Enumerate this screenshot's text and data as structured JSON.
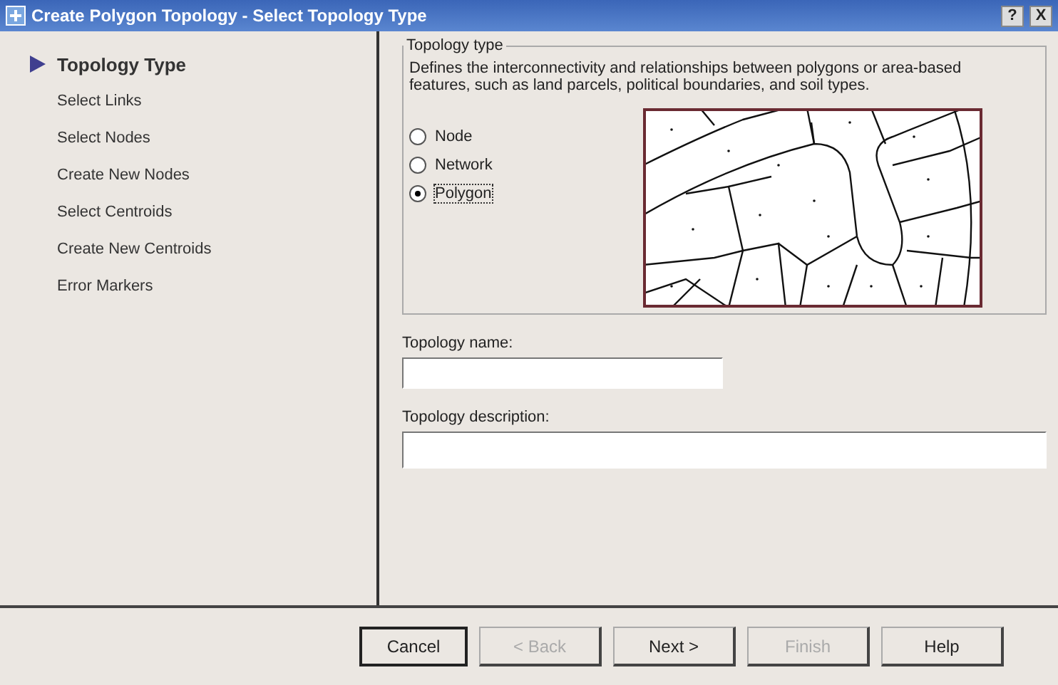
{
  "window": {
    "title": "Create Polygon Topology - Select Topology Type",
    "help": "?",
    "close": "X"
  },
  "steps": [
    {
      "label": "Topology Type",
      "selected": true
    },
    {
      "label": "Select Links",
      "selected": false
    },
    {
      "label": "Select Nodes",
      "selected": false
    },
    {
      "label": "Create New Nodes",
      "selected": false
    },
    {
      "label": "Select Centroids",
      "selected": false
    },
    {
      "label": "Create New Centroids",
      "selected": false
    },
    {
      "label": "Error Markers",
      "selected": false
    }
  ],
  "group": {
    "title": "Topology type",
    "description": "Defines the interconnectivity and relationships between polygons or area-based features, such as land parcels, political boundaries, and soil types.",
    "options": [
      {
        "label": "Node",
        "selected": false
      },
      {
        "label": "Network",
        "selected": false
      },
      {
        "label": "Polygon",
        "selected": true
      }
    ]
  },
  "fields": [
    {
      "label": "Topology name:"
    },
    {
      "label": "Topology description:"
    }
  ],
  "buttons": [
    {
      "label": "Cancel",
      "disabled": false,
      "default": true
    },
    {
      "label": "< Back",
      "disabled": true,
      "default": false
    },
    {
      "label": "Next >",
      "disabled": false,
      "default": false
    },
    {
      "label": "Finish",
      "disabled": true,
      "default": false
    },
    {
      "label": "Help",
      "disabled": false,
      "default": false
    }
  ]
}
